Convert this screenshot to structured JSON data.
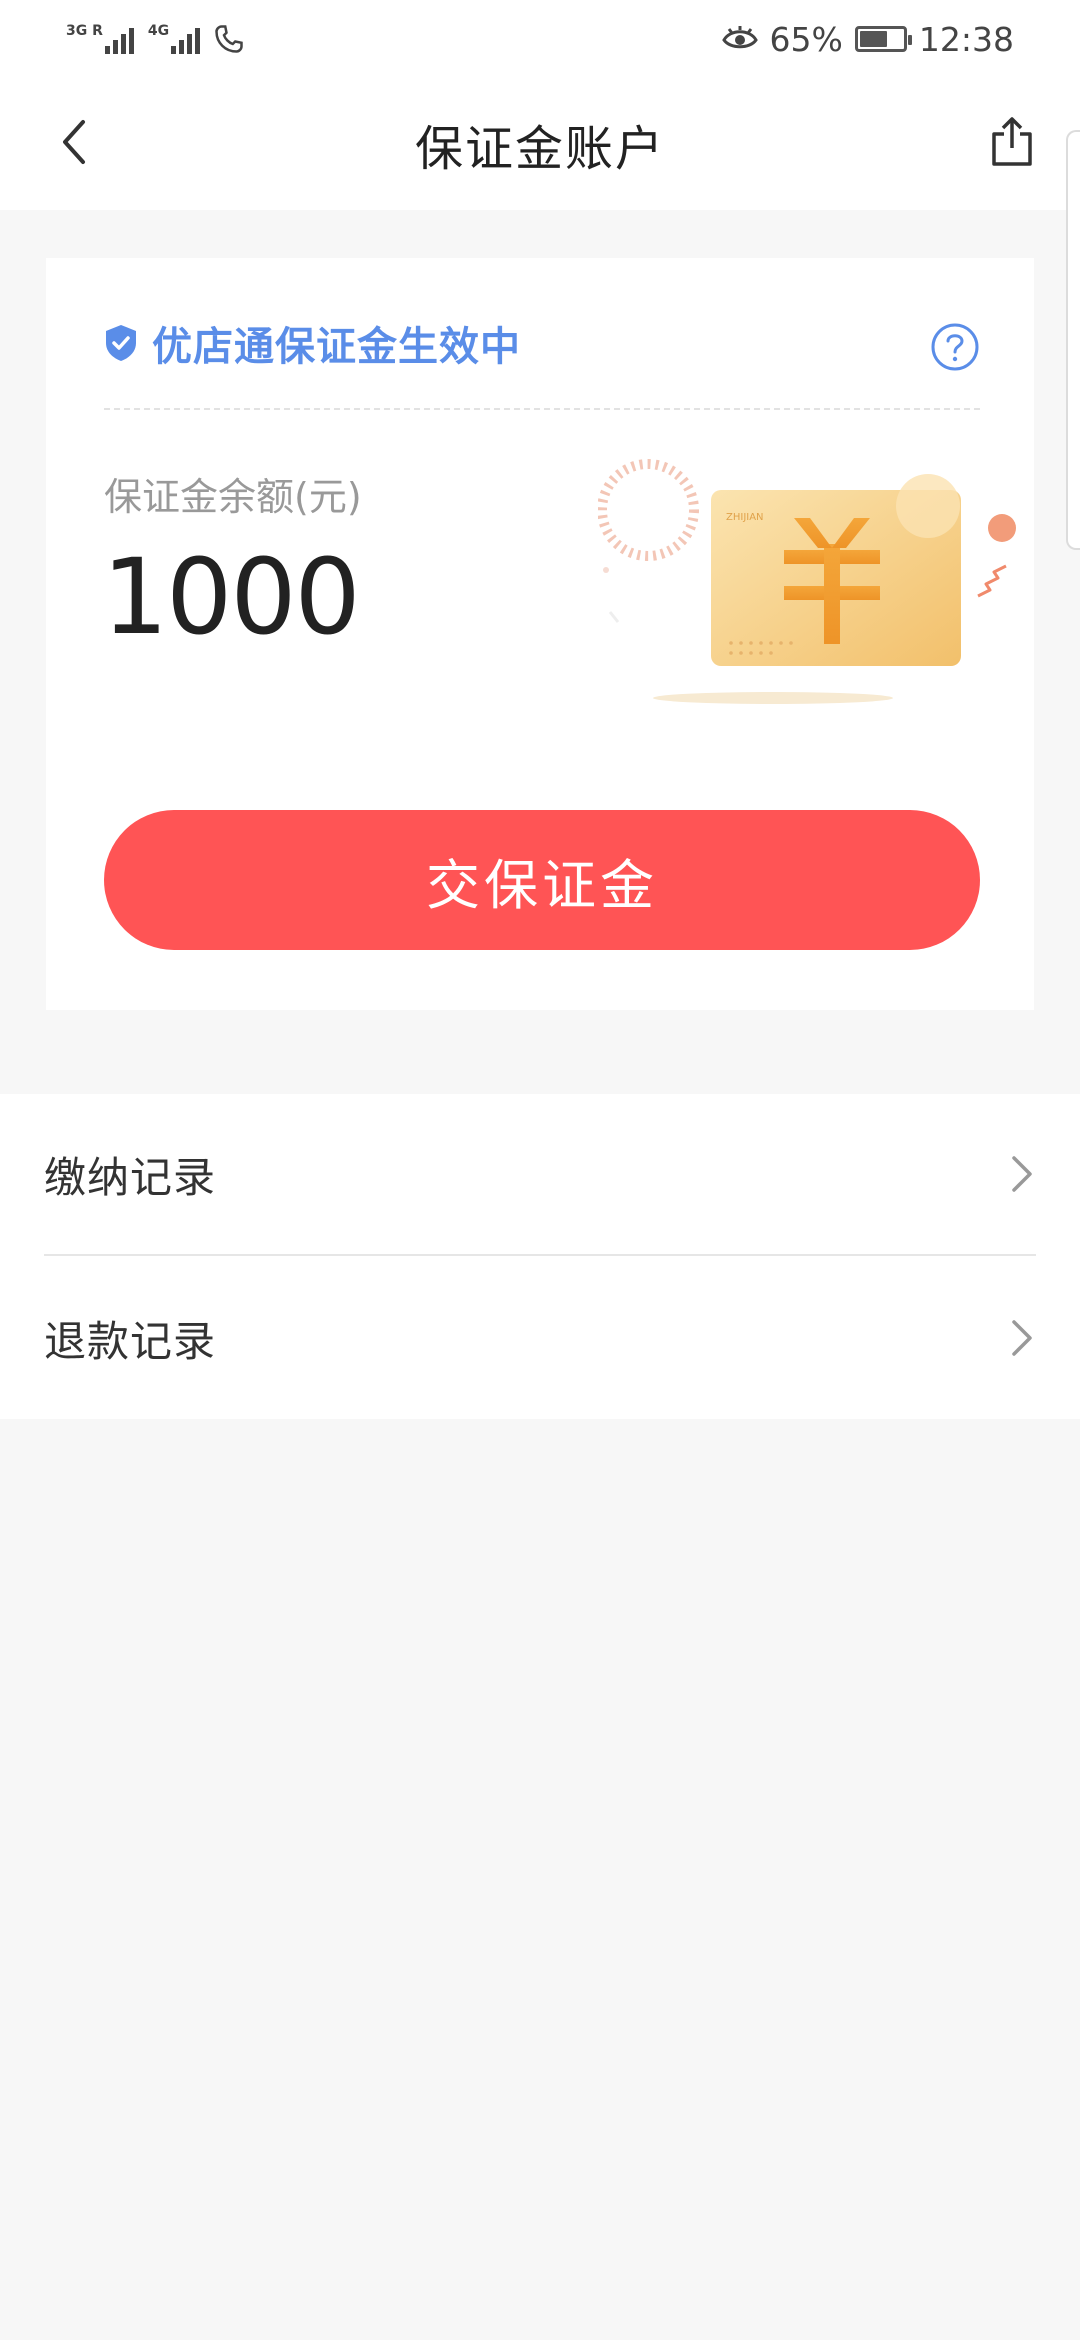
{
  "status_bar": {
    "network1": "3G R",
    "network2": "4G",
    "battery_percent": "65%",
    "time": "12:38",
    "icons": [
      "signal-icon",
      "call-icon",
      "eye-icon",
      "battery-icon"
    ],
    "battery_level": 0.65
  },
  "nav": {
    "title": "保证金账户",
    "back_icon": "back-arrow-icon",
    "share_icon": "share-icon"
  },
  "card": {
    "status_text": "优店通保证金生效中",
    "balance_label": "保证金余额(元)",
    "balance_value": "1000",
    "button_label": "交保证金",
    "illustration_text": "ZHIJIAN"
  },
  "list": {
    "items": [
      {
        "label": "缴纳记录"
      },
      {
        "label": "退款记录"
      }
    ]
  },
  "colors": {
    "accent_blue": "#5a8de8",
    "button_red": "#ff5455",
    "background": "#f7f7f7",
    "card_gold": "#f5cf83"
  }
}
